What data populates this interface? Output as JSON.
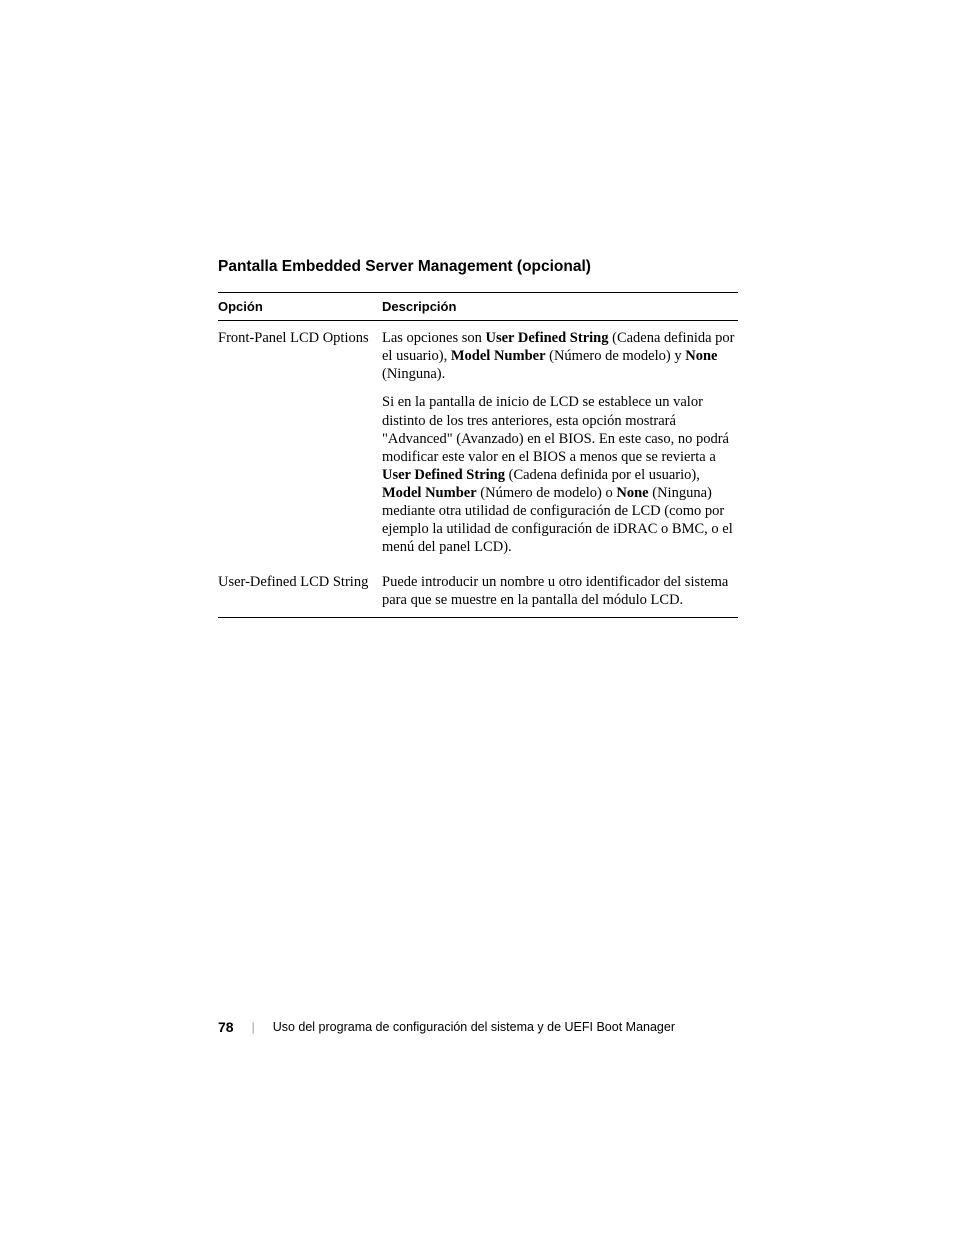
{
  "section": {
    "title": "Pantalla Embedded Server Management (opcional)"
  },
  "table": {
    "headers": {
      "opcion": "Opción",
      "descripcion": "Descripción"
    },
    "rows": {
      "row1": {
        "opcion": "Front-Panel LCD Options",
        "desc1_pre": "Las opciones son ",
        "desc1_b1": "User Defined String",
        "desc1_mid1": " (Cadena definida por el usuario), ",
        "desc1_b2": "Model Number",
        "desc1_mid2": " (Número de modelo) y ",
        "desc1_b3": "None",
        "desc1_post": " (Ninguna).",
        "desc2_pre": "Si en la pantalla de inicio de LCD se establece un valor distinto de los tres anteriores, esta opción mostrará \"Advanced\" (Avanzado) en el BIOS. En este caso, no podrá modificar este valor en el BIOS a menos que se revierta a ",
        "desc2_b1": "User Defined String",
        "desc2_mid1": " (Cadena definida por el usuario), ",
        "desc2_b2": "Model Number",
        "desc2_mid2": " (Número de modelo) o ",
        "desc2_b3": "None",
        "desc2_post": " (Ninguna) mediante otra utilidad de configuración de LCD (como por ejemplo la utilidad de configuración de iDRAC o BMC, o el menú del panel LCD)."
      },
      "row2": {
        "opcion": "User-Defined LCD String",
        "desc": "Puede introducir un nombre u otro identificador del sistema para que se muestre en la pantalla del módulo LCD."
      }
    }
  },
  "footer": {
    "page": "78",
    "divider": "|",
    "text": "Uso del programa de configuración del sistema y de UEFI Boot Manager"
  }
}
